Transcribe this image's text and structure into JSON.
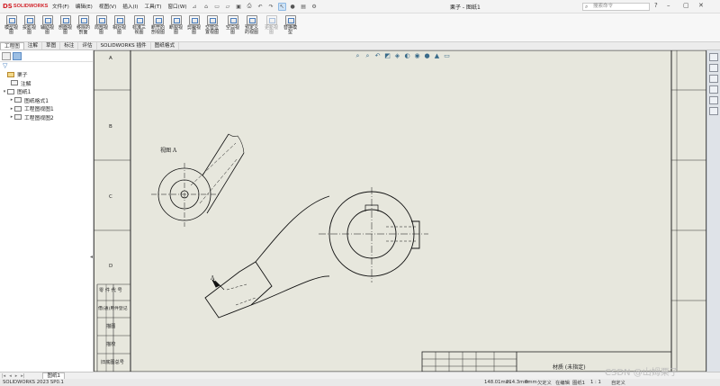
{
  "app": {
    "logo_brand": "DS",
    "logo_text": "SOLIDWORKS",
    "document_title": "栗子 - 图纸1",
    "search_placeholder": "搜索命令"
  },
  "menu": [
    {
      "label": "文件(F)"
    },
    {
      "label": "编辑(E)"
    },
    {
      "label": "视图(V)"
    },
    {
      "label": "插入(I)"
    },
    {
      "label": "工具(T)"
    },
    {
      "label": "窗口(W)"
    }
  ],
  "toolbar": [
    {
      "label": "模型视图",
      "enabled": true
    },
    {
      "label": "投影视图",
      "enabled": true
    },
    {
      "label": "辅助视图",
      "enabled": true
    },
    {
      "label": "剖面视图",
      "enabled": true
    },
    {
      "label": "移除的剖面",
      "enabled": true
    },
    {
      "label": "局部视图",
      "enabled": true
    },
    {
      "label": "相对视图",
      "enabled": true
    },
    {
      "label": "标准三视图",
      "enabled": true
    },
    {
      "label": "断开的剖视图",
      "enabled": true
    },
    {
      "label": "断裂视图",
      "enabled": true
    },
    {
      "label": "剪裁视图",
      "enabled": true
    },
    {
      "label": "交替位置视图",
      "enabled": true
    },
    {
      "label": "空白视图",
      "enabled": true
    },
    {
      "label": "预定义的视图",
      "enabled": true
    },
    {
      "label": "更新视图",
      "enabled": false
    },
    {
      "label": "替换模型",
      "enabled": true
    }
  ],
  "tabs": [
    {
      "label": "工程图",
      "active": true
    },
    {
      "label": "注解",
      "active": false
    },
    {
      "label": "草图",
      "active": false
    },
    {
      "label": "标注",
      "active": false
    },
    {
      "label": "评估",
      "active": false
    },
    {
      "label": "SOLIDWORKS 插件",
      "active": false
    },
    {
      "label": "图纸格式",
      "active": false
    }
  ],
  "tree": [
    {
      "label": "栗子",
      "level": 0,
      "expander": "",
      "icon": "drawing-icon"
    },
    {
      "label": "注解",
      "level": 1,
      "expander": "",
      "icon": "annotation-folder-icon"
    },
    {
      "label": "图纸1",
      "level": 1,
      "expander": "▾",
      "icon": "sheet-icon"
    },
    {
      "label": "图纸格式1",
      "level": 2,
      "expander": "▸",
      "icon": "sheet-format-icon"
    },
    {
      "label": "工程图视图1",
      "level": 2,
      "expander": "▸",
      "icon": "drawing-view-icon"
    },
    {
      "label": "工程图视图2",
      "level": 2,
      "expander": "▸",
      "icon": "drawing-view-icon"
    }
  ],
  "drawing": {
    "row_labels": [
      "A",
      "B",
      "C",
      "D"
    ],
    "view_label": "视图 A",
    "section_marker": "A",
    "left_column_labels": [
      "零 件 代 号",
      "借(通)用件登记",
      "描图",
      "描校",
      "旧底图总号"
    ],
    "material": "材质 (未指定)"
  },
  "sheet_tab": "图纸1",
  "status": {
    "app_version": "SOLIDWORKS 2023 SP0.1",
    "x": "148.01mm",
    "y": "214.3mm",
    "z": "0mm",
    "state": "欠定义",
    "mode": "在编辑",
    "sheet": "图纸1",
    "scale": "1 : 1",
    "units": "自定义"
  },
  "watermark": "CSDN @山姆栗子"
}
